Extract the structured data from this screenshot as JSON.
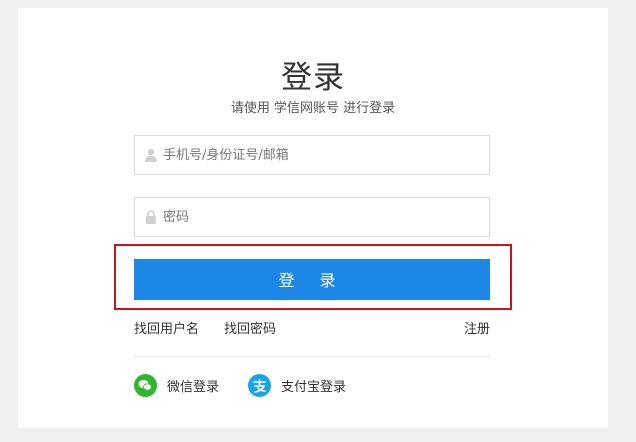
{
  "login": {
    "title": "登录",
    "subtitle": "请使用 学信网账号 进行登录",
    "username_placeholder": "手机号/身份证号/邮箱",
    "password_placeholder": "密码",
    "submit_label": "登 录"
  },
  "links": {
    "find_username": "找回用户名",
    "find_password": "找回密码",
    "register": "注册"
  },
  "social": {
    "wechat_label": "微信登录",
    "alipay_label": "支付宝登录"
  },
  "colors": {
    "primary": "#1c87e6",
    "highlight_border": "#c8161d",
    "wechat": "#2cb72c",
    "alipay": "#1aa3e8"
  }
}
